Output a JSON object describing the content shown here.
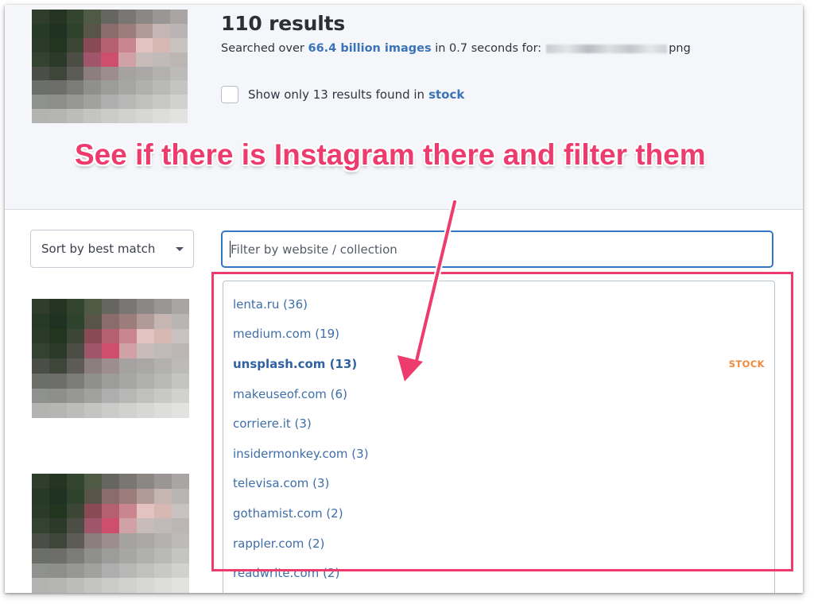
{
  "header": {
    "results_title": "110 results",
    "search_prefix": "Searched over",
    "images_count": "66.4 billion images",
    "search_suffix": "in 0.7 seconds for:",
    "query_extension": "png",
    "stock_filter_text": "Show only 13 results found in",
    "stock_filter_link": "stock",
    "stock_checked": false
  },
  "annotation": {
    "text": "See if there is Instagram there and filter them",
    "color": "#ee3b6e"
  },
  "controls": {
    "sort_label": "Sort by best match",
    "filter_placeholder": "Filter by website / collection",
    "filter_value": ""
  },
  "dropdown": {
    "items": [
      {
        "label": "lenta.ru (36)",
        "bold": false,
        "tag": ""
      },
      {
        "label": "medium.com (19)",
        "bold": false,
        "tag": ""
      },
      {
        "label": "unsplash.com (13)",
        "bold": true,
        "tag": "STOCK"
      },
      {
        "label": "makeuseof.com (6)",
        "bold": false,
        "tag": ""
      },
      {
        "label": "corriere.it (3)",
        "bold": false,
        "tag": ""
      },
      {
        "label": "insidermonkey.com (3)",
        "bold": false,
        "tag": ""
      },
      {
        "label": "televisa.com (3)",
        "bold": false,
        "tag": ""
      },
      {
        "label": "gothamist.com (2)",
        "bold": false,
        "tag": ""
      },
      {
        "label": "rappler.com (2)",
        "bold": false,
        "tag": ""
      },
      {
        "label": "readwrite.com (2)",
        "bold": false,
        "tag": ""
      }
    ]
  },
  "colors": {
    "accent_blue": "#3a73b8",
    "stock_tag": "#f08a3a",
    "header_bg": "#f4f6fa",
    "annotation_pink": "#ee3b6e"
  },
  "icons": {
    "sort_caret": "caret-down-icon"
  }
}
